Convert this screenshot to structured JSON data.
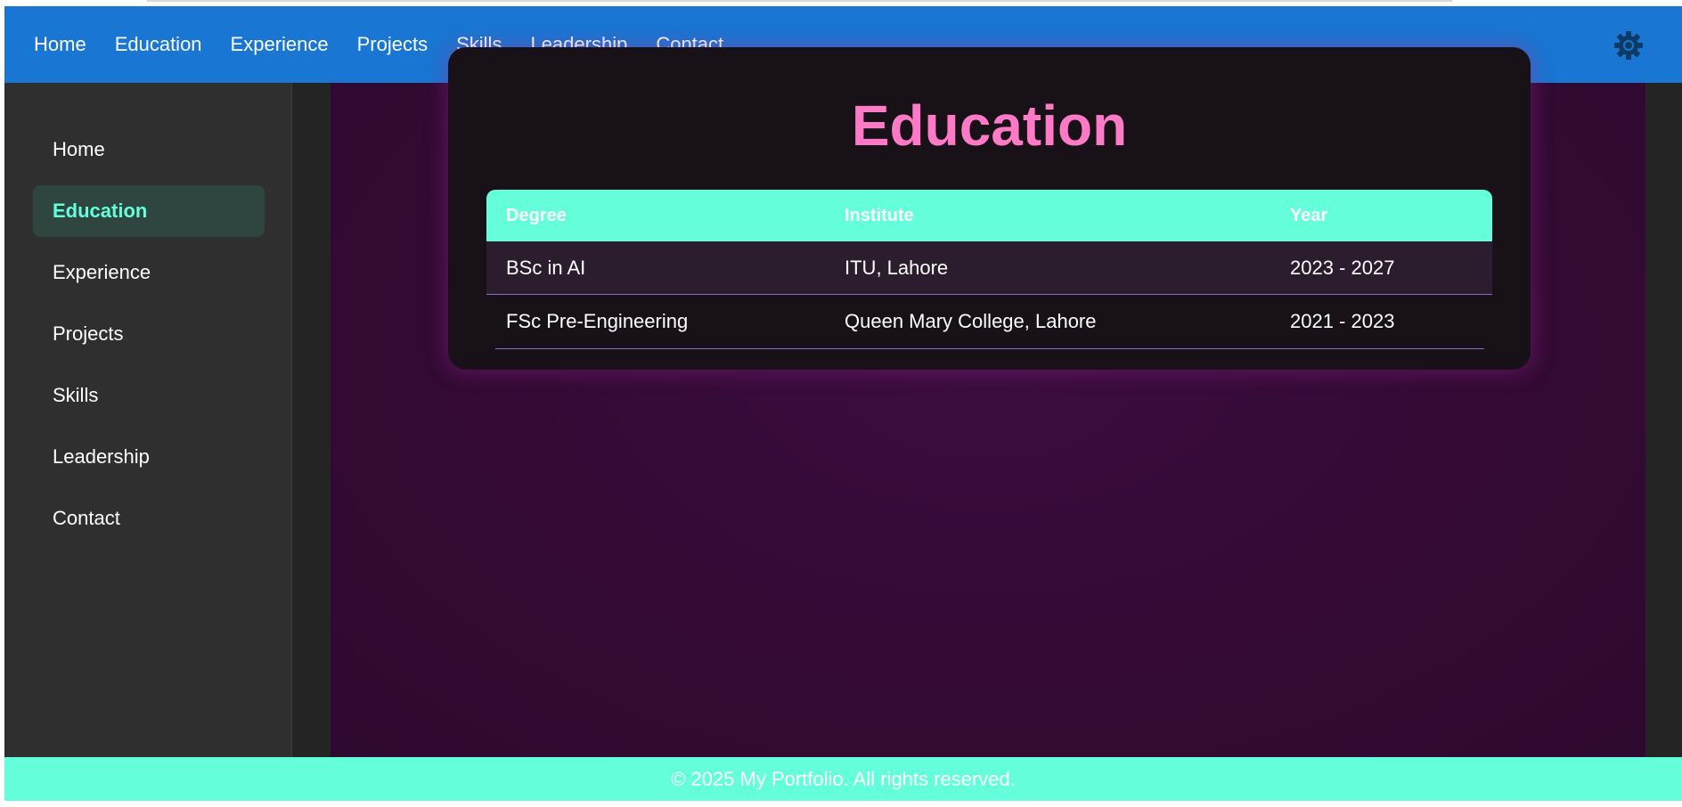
{
  "navbar": {
    "links": [
      "Home",
      "Education",
      "Experience",
      "Projects",
      "Skills",
      "Leadership",
      "Contact"
    ],
    "theme_icon": "sun-gear-icon",
    "color": "#1976d2"
  },
  "sidebar": {
    "items": [
      {
        "label": "Home",
        "active": false
      },
      {
        "label": "Education",
        "active": true
      },
      {
        "label": "Experience",
        "active": false
      },
      {
        "label": "Projects",
        "active": false
      },
      {
        "label": "Skills",
        "active": false
      },
      {
        "label": "Leadership",
        "active": false
      },
      {
        "label": "Contact",
        "active": false
      }
    ]
  },
  "main": {
    "section_title": "Education",
    "table": {
      "headers": [
        "Degree",
        "Institute",
        "Year"
      ],
      "rows": [
        [
          "BSc in AI",
          "ITU, Lahore",
          "2023 - 2027"
        ],
        [
          "FSc Pre-Engineering",
          "Queen Mary College, Lahore",
          "2021 - 2023"
        ]
      ]
    }
  },
  "footer": {
    "text": "© 2025 My Portfolio. All rights reserved."
  },
  "colors": {
    "accent": "#64ffda",
    "title": "#ff7ac6",
    "background": "#330a33"
  }
}
